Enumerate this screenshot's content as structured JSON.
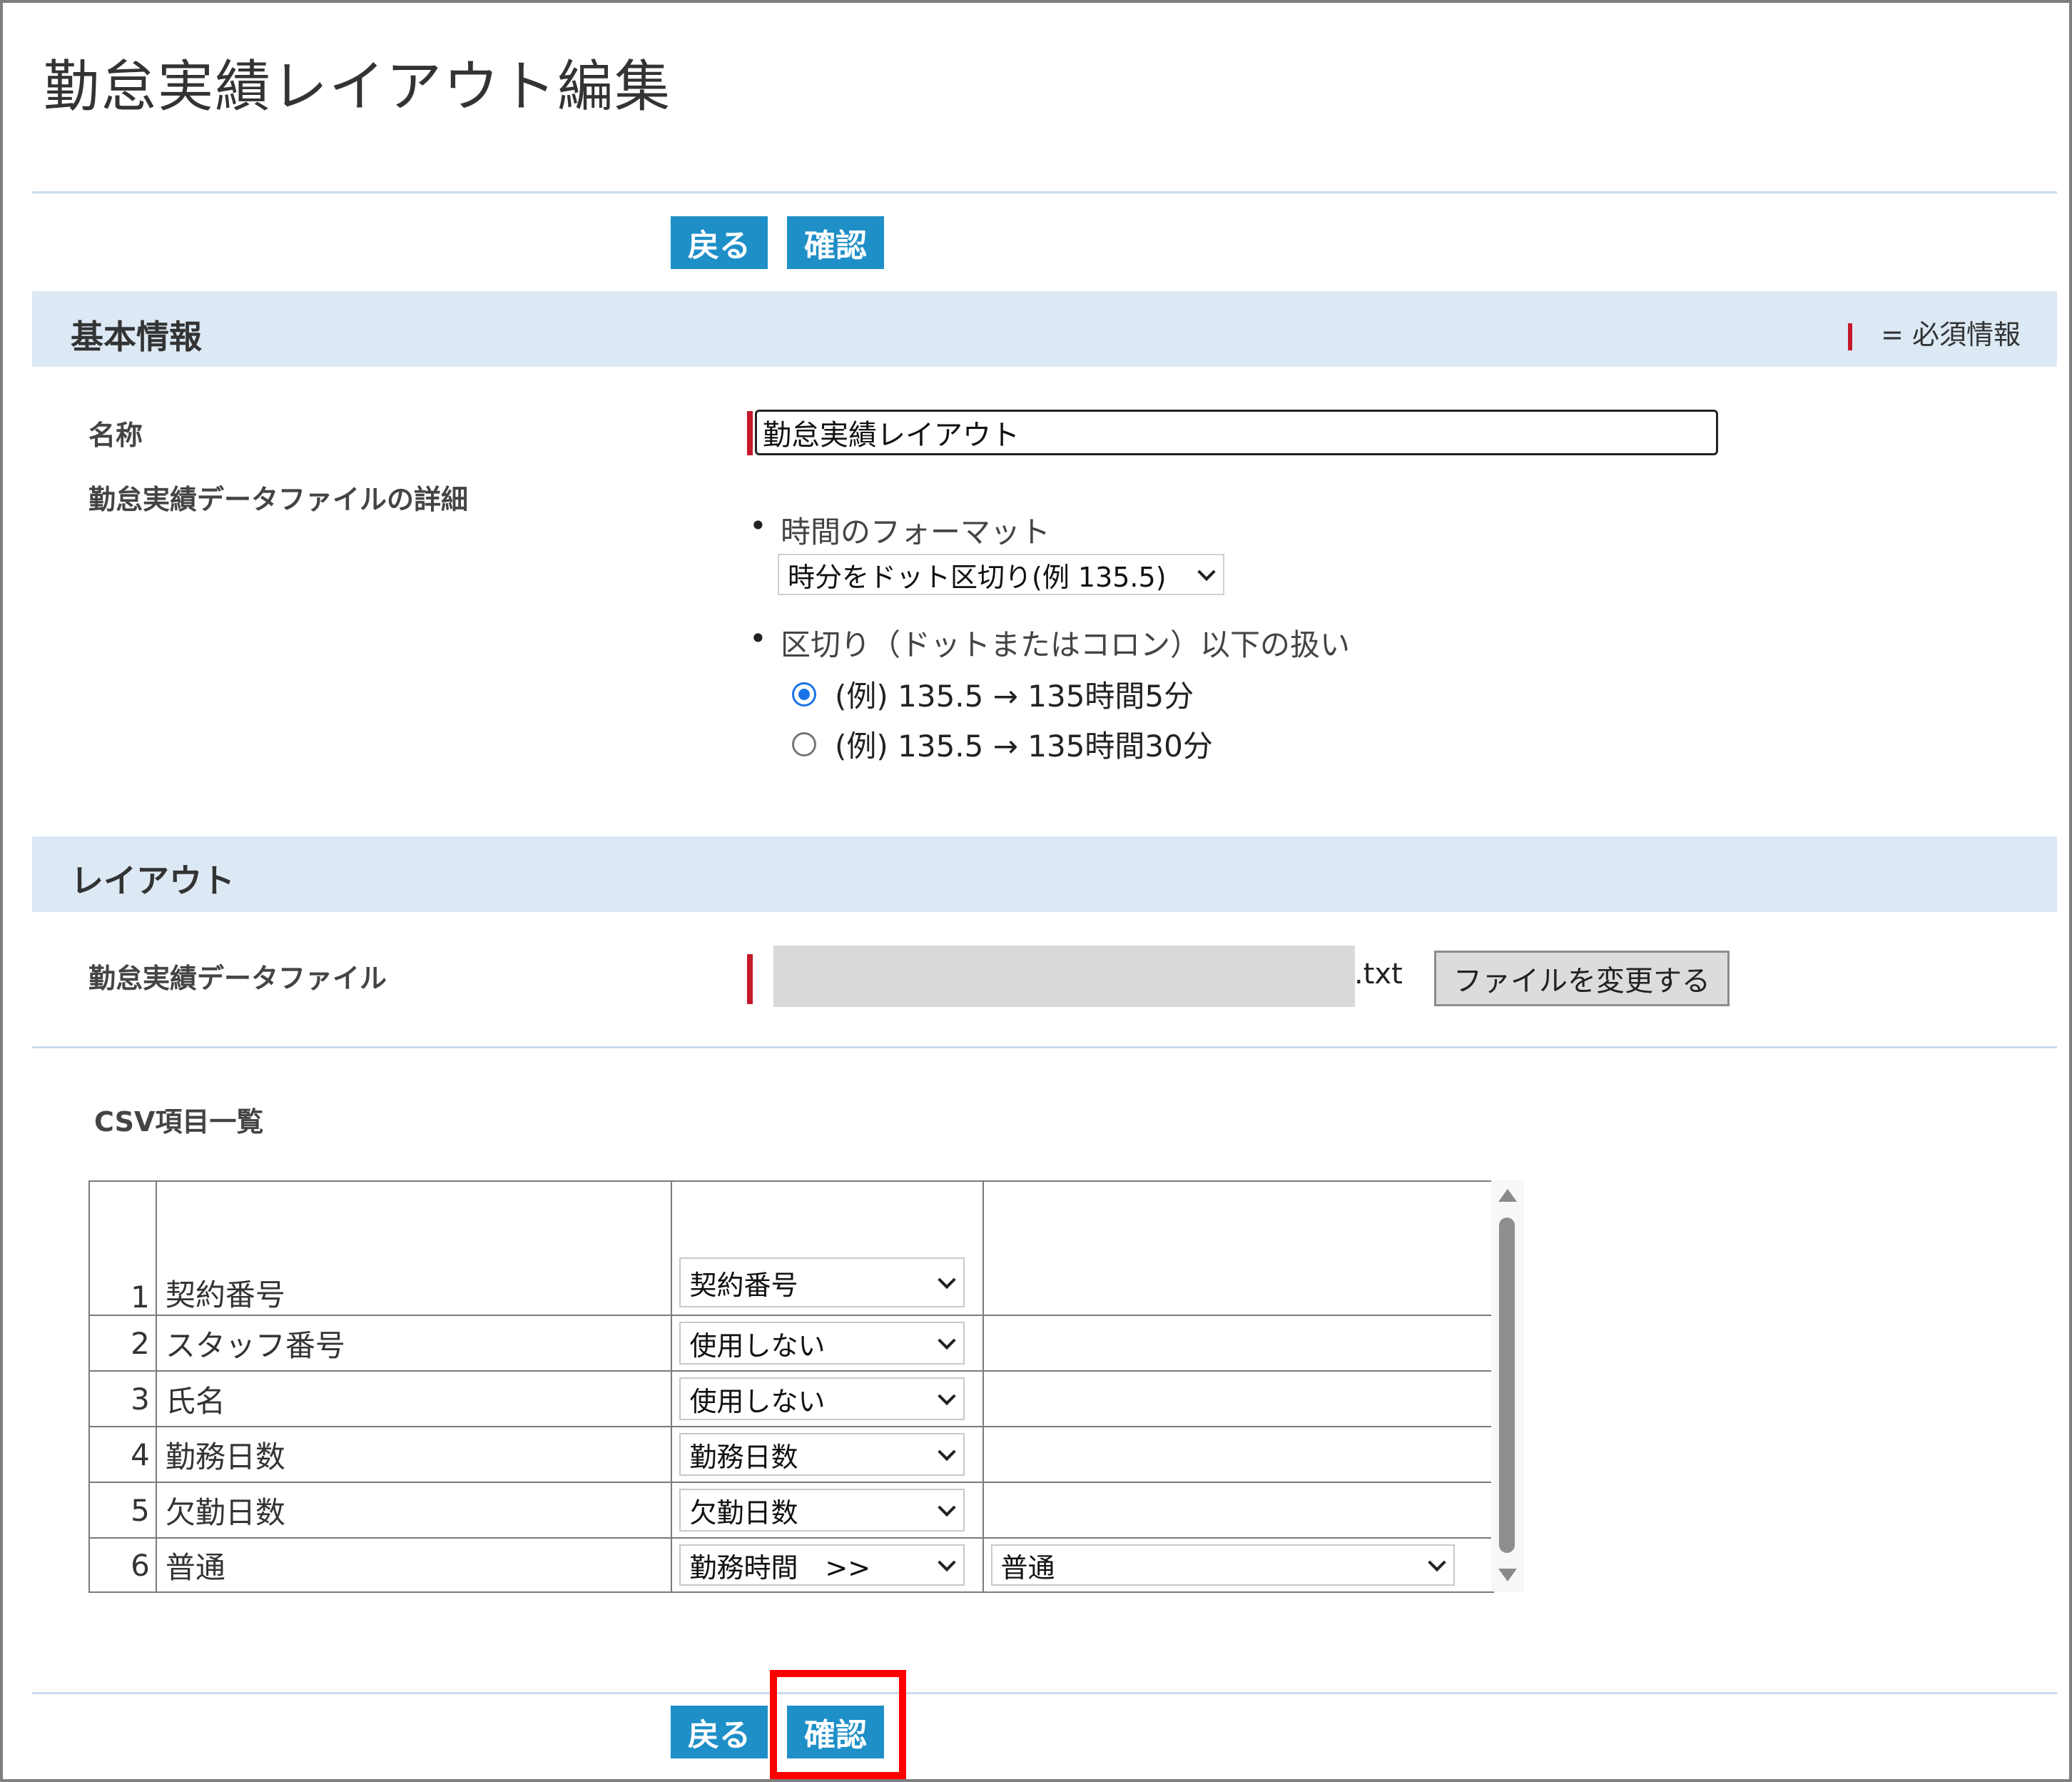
{
  "page": {
    "title": "勤怠実績レイアウト編集"
  },
  "top_buttons": {
    "back": "戻る",
    "confirm": "確認"
  },
  "basic_section": {
    "heading": "基本情報",
    "required_legend": "= 必須情報",
    "name_label": "名称",
    "name_value": "勤怠実績レイアウト",
    "detail_label": "勤怠実績データファイルの詳細",
    "time_format_label": "時間のフォーマット",
    "time_format_selected": "時分をドット区切り(例 135.5)",
    "delimiter_label": "区切り（ドットまたはコロン）以下の扱い",
    "radio_options": [
      {
        "label": "(例) 135.5 → 135時間5分",
        "checked": true
      },
      {
        "label": "(例) 135.5 → 135時間30分",
        "checked": false
      }
    ]
  },
  "layout_section": {
    "heading": "レイアウト",
    "file_label": "勤怠実績データファイル",
    "file_ext": ".txt",
    "change_file_button": "ファイルを変更する"
  },
  "csv": {
    "title": "CSV項目一覧",
    "rows": [
      {
        "num": "1",
        "name": "契約番号",
        "mapping": "契約番号",
        "sub": ""
      },
      {
        "num": "2",
        "name": "スタッフ番号",
        "mapping": "使用しない",
        "sub": ""
      },
      {
        "num": "3",
        "name": "氏名",
        "mapping": "使用しない",
        "sub": ""
      },
      {
        "num": "4",
        "name": "勤務日数",
        "mapping": "勤務日数",
        "sub": ""
      },
      {
        "num": "5",
        "name": "欠勤日数",
        "mapping": "欠勤日数",
        "sub": ""
      },
      {
        "num": "6",
        "name": "普通",
        "mapping": "勤務時間　>>",
        "sub": "普通"
      }
    ]
  },
  "bottom_buttons": {
    "back": "戻る",
    "confirm": "確認"
  },
  "colors": {
    "button": "#1e8fc7",
    "section_bg": "#dce9f5",
    "required": "#c5182a",
    "highlight": "#ff0000",
    "radio_on": "#1a73e8"
  }
}
